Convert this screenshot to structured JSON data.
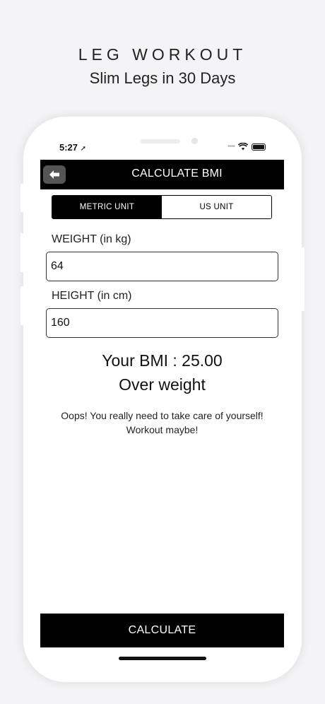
{
  "promo": {
    "title": "LEG WORKOUT",
    "subtitle": "Slim Legs in 30 Days"
  },
  "status_bar": {
    "time": "5:27"
  },
  "nav": {
    "title": "CALCULATE BMI",
    "back_icon": "arrow-left-icon"
  },
  "unit_toggle": {
    "options": [
      "METRIC UNIT",
      "US UNIT"
    ],
    "selected": "METRIC UNIT"
  },
  "weight": {
    "label": "WEIGHT (in kg)",
    "value": "64"
  },
  "height": {
    "label": "HEIGHT (in cm)",
    "value": "160"
  },
  "result": {
    "bmi": "Your BMI : 25.00",
    "status": "Over weight",
    "message_line1": "Oops! You really need to take care of yourself!",
    "message_line2": "Workout maybe!"
  },
  "actions": {
    "calculate_label": "CALCULATE"
  },
  "colors": {
    "accent": "#000000",
    "background": "#f4f4f6",
    "back_button": "#555555"
  }
}
